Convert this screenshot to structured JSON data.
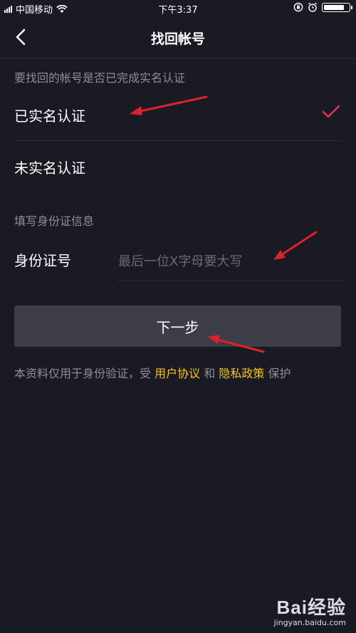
{
  "status_bar": {
    "carrier": "中国移动",
    "time": "下午3:37",
    "battery_level": 0.85
  },
  "nav": {
    "title": "找回帐号",
    "back_icon": "chevron-left-icon"
  },
  "form": {
    "question": "要找回的帐号是否已完成实名认证",
    "options": [
      {
        "label": "已实名认证",
        "selected": true
      },
      {
        "label": "未实名认证",
        "selected": false
      }
    ],
    "id_section_label": "填写身份证信息",
    "id_field_label": "身份证号",
    "id_field_placeholder": "最后一位X字母要大写",
    "id_field_value": ""
  },
  "next_button_label": "下一步",
  "disclaimer": {
    "prefix": "本资料仅用于身份验证，受",
    "user_agreement": "用户协议",
    "and": "和",
    "privacy_policy": "隐私政策",
    "suffix": "保护"
  },
  "watermark": {
    "brand": "Bai经验",
    "url": "jingyan.baidu.com"
  },
  "colors": {
    "background": "#1a1a24",
    "check": "#e8344e",
    "link": "#f5c518",
    "annotation_arrow": "#e0202a",
    "button": "#3d3d48"
  }
}
